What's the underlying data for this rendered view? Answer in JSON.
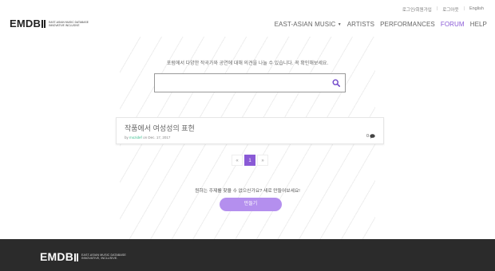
{
  "topbar": {
    "link1": "로그인/회원가입",
    "link2": "로그아웃",
    "link3": "English"
  },
  "logo": {
    "mark": "EMDB",
    "line1": "EAST-ASIAN MUSIC DATABASE",
    "line2": "INNOVATIVE INCLUSIVE"
  },
  "nav": {
    "east_asian_music": "EAST-ASIAN MUSIC",
    "artists": "ARTISTS",
    "performances": "PERFORMANCES",
    "forum": "FORUM",
    "help": "HELP"
  },
  "main": {
    "intro": "포럼에서 다양한 작곡가와 공연에 대해 의견을 나눌 수 있습니다. 꼭 확인해보세요.",
    "search_placeholder": ""
  },
  "post": {
    "title": "작품에서 여성성의 표현",
    "by": "by",
    "author": "mozidef",
    "date_prefix": "on",
    "date": "Dec. 17, 2017",
    "comments": "0"
  },
  "pagination": {
    "prev": "«",
    "current": "1",
    "next": "»"
  },
  "cta": {
    "prompt": "원하는 주제를 찾을 수 없으신가요? 새로 만들어보세요!",
    "button": "만들기"
  },
  "footer": {
    "mark": "EMDB",
    "line1": "EAST-ASIAN MUSIC DATABASE",
    "line2": "INNOVATIVE, INCLUSIVE."
  },
  "colors": {
    "accent": "#8a5ad6",
    "button": "#b48fee",
    "author": "#3cbf8f",
    "footer": "#2b2b2b"
  },
  "icons": {
    "search": "search-icon",
    "comment": "comment-icon",
    "caret": "chevron-down-icon"
  }
}
